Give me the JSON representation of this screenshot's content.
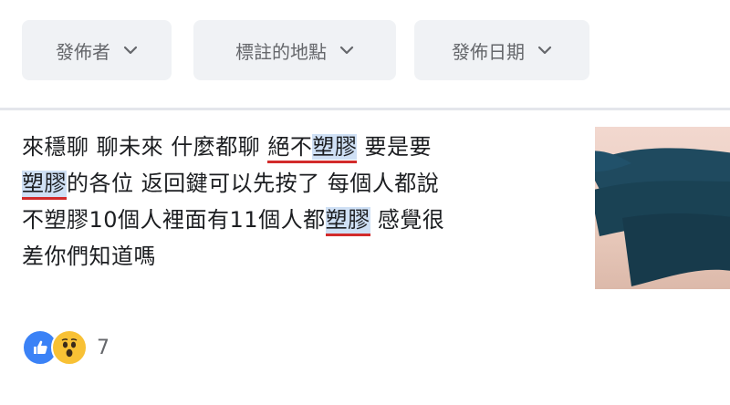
{
  "filters": [
    {
      "label": "發佈者"
    },
    {
      "label": "標註的地點"
    },
    {
      "label": "發佈日期"
    }
  ],
  "post": {
    "lines": [
      [
        "來穩聊 聊未來 什麼都聊 ",
        "絕不",
        "塑膠",
        " 要是要"
      ],
      [
        "塑膠",
        "的各位 返回鍵可以先按了 每個人都說"
      ],
      [
        "不塑膠10個人裡面有11個人都",
        "塑膠",
        " 感覺很"
      ],
      [
        "差你們知道嗎"
      ]
    ]
  },
  "reactions": {
    "count": "7",
    "icons": [
      "like-icon",
      "wow-icon"
    ]
  },
  "colors": {
    "highlight": "#cfe0f5",
    "underline": "#d22b2b",
    "chip_bg": "#f0f2f5",
    "like_blue": "#3b82f6",
    "wow_yellow": "#f8c135"
  }
}
